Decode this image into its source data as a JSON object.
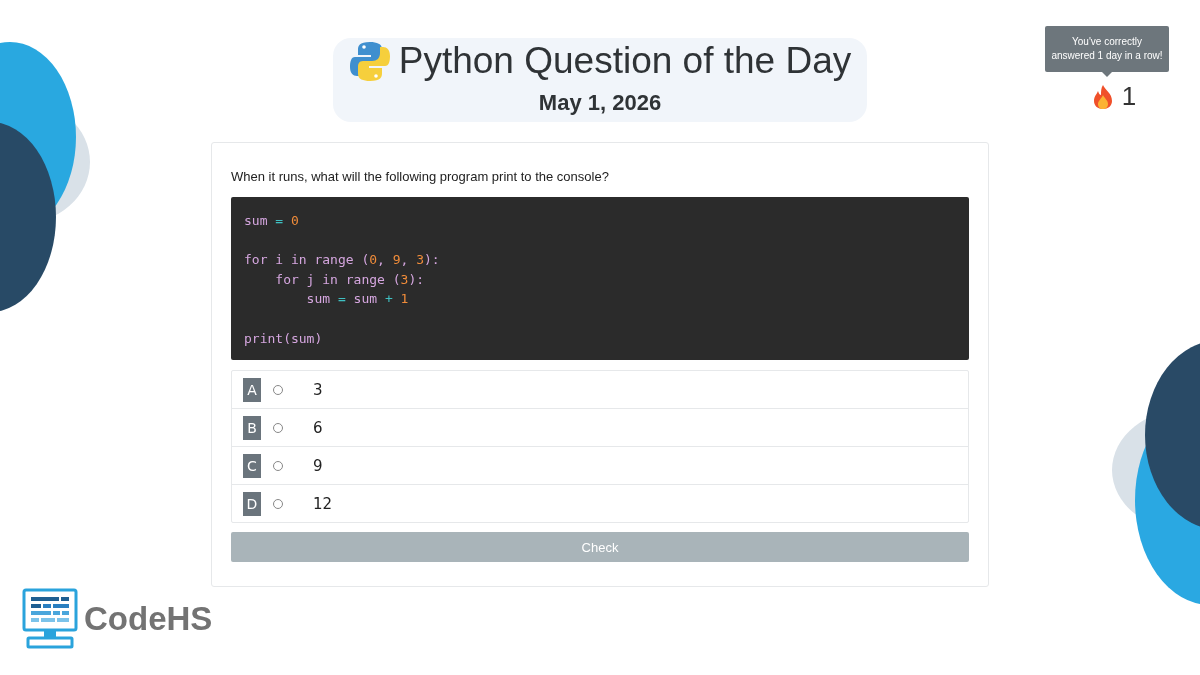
{
  "header": {
    "title": "Python Question of the Day",
    "date": "May 1, 2026"
  },
  "streak": {
    "tooltip": "You've correctly answered 1 day in a row!",
    "count": "1"
  },
  "question": {
    "prompt": "When it runs, what will the following program print to the console?",
    "code": [
      {
        "kind": "code",
        "tokens": [
          {
            "kind": "name",
            "text": "sum "
          },
          {
            "kind": "op",
            "text": "="
          },
          {
            "kind": "num",
            "text": " 0"
          }
        ]
      },
      {
        "kind": "blank"
      },
      {
        "kind": "code",
        "tokens": [
          {
            "kind": "name",
            "text": "for i in range ("
          },
          {
            "kind": "num",
            "text": "0"
          },
          {
            "kind": "name",
            "text": ", "
          },
          {
            "kind": "num",
            "text": "9"
          },
          {
            "kind": "name",
            "text": ", "
          },
          {
            "kind": "num",
            "text": "3"
          },
          {
            "kind": "name",
            "text": "):"
          }
        ]
      },
      {
        "kind": "code",
        "tokens": [
          {
            "kind": "name",
            "text": "    for j in range ("
          },
          {
            "kind": "num",
            "text": "3"
          },
          {
            "kind": "name",
            "text": "):"
          }
        ]
      },
      {
        "kind": "code",
        "tokens": [
          {
            "kind": "name",
            "text": "        sum "
          },
          {
            "kind": "op",
            "text": "="
          },
          {
            "kind": "name",
            "text": " sum "
          },
          {
            "kind": "op",
            "text": "+"
          },
          {
            "kind": "num",
            "text": " 1"
          }
        ]
      },
      {
        "kind": "blank"
      },
      {
        "kind": "code",
        "tokens": [
          {
            "kind": "name",
            "text": "print(sum)"
          }
        ]
      }
    ],
    "choices": [
      {
        "letter": "A",
        "answer": "3",
        "selected": false
      },
      {
        "letter": "B",
        "answer": "6",
        "selected": false
      },
      {
        "letter": "C",
        "answer": "9",
        "selected": false
      },
      {
        "letter": "D",
        "answer": "12",
        "selected": false
      }
    ],
    "check_button": {
      "label": "Check",
      "disabled": true
    }
  },
  "logo": {
    "text": "CodeHS"
  }
}
